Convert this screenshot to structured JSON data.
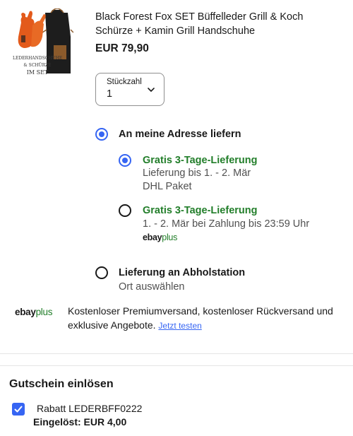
{
  "product": {
    "title": "Black Forest Fox SET Büffelleder Grill & Koch Schürze + Kamin Grill Handschuhe",
    "price": "EUR 79,90",
    "image_caption": [
      "LEDERHANDSCHUHE",
      "& SCHÜRZE",
      "IM SET"
    ]
  },
  "quantity": {
    "label": "Stückzahl",
    "value": "1"
  },
  "delivery": {
    "home_label": "An meine Adresse liefern",
    "home_selected": true,
    "options": [
      {
        "title": "Gratis 3-Tage-Lieferung",
        "line1": "Lieferung bis 1. - 2. Mär",
        "line2": "DHL Paket",
        "selected": true
      },
      {
        "title": "Gratis 3-Tage-Lieferung",
        "line1": "1. - 2. Mär bei Zahlung bis 23:59 Uhr",
        "badge_ebay": "ebay",
        "badge_plus": "plus",
        "selected": false
      }
    ],
    "pickup_label": "Lieferung an Abholstation",
    "pickup_sub": "Ort auswählen"
  },
  "plus_promo": {
    "logo_ebay": "ebay",
    "logo_plus": "plus",
    "text": "Kostenloser Premiumversand, kostenloser Rückversand und exklusive Angebote.",
    "link": "Jetzt testen"
  },
  "coupon": {
    "title": "Gutschein einlösen",
    "code_line": "Rabatt LEDERBFF0222",
    "redeemed": "Eingelöst: EUR 4,00",
    "checked": true
  },
  "colors": {
    "accent_blue": "#3665f3",
    "plus_green": "#227e2a"
  }
}
